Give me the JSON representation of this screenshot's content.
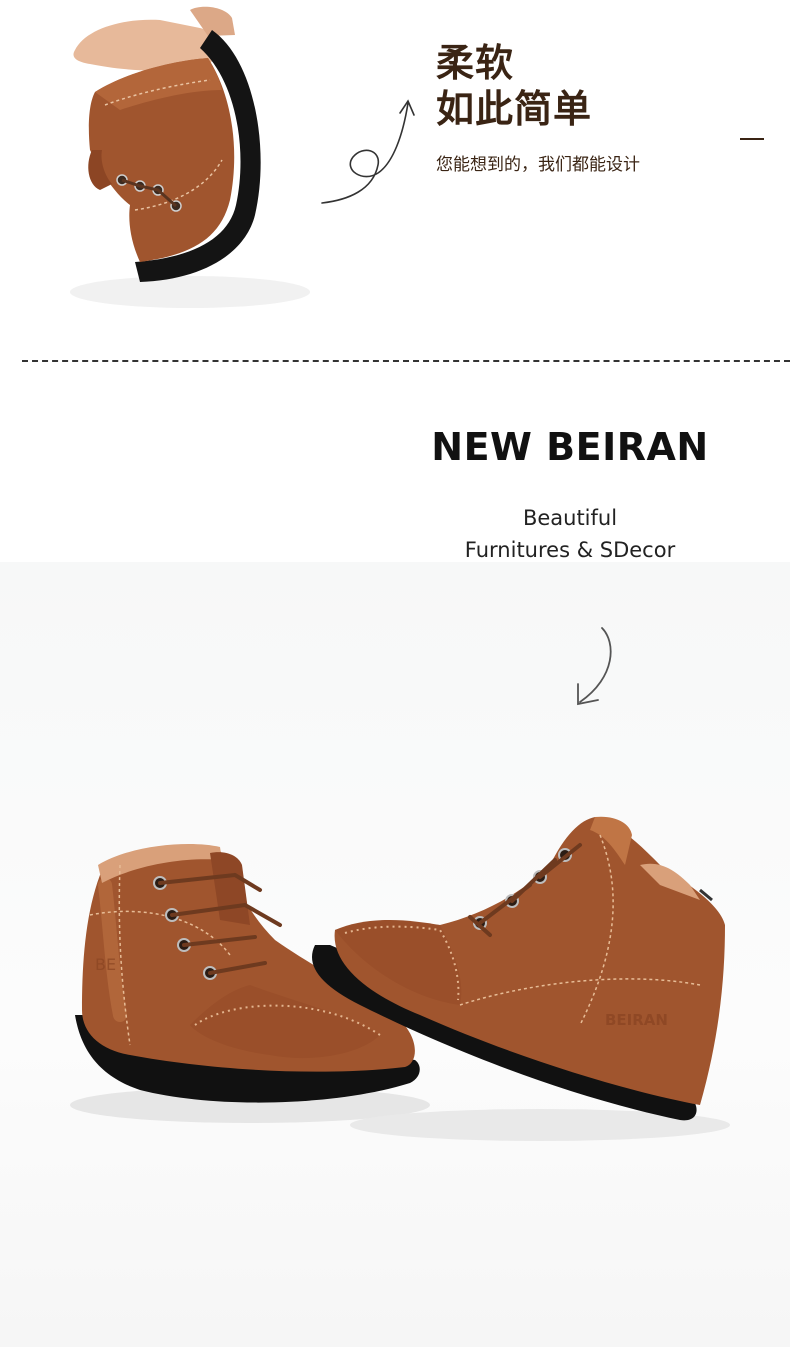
{
  "hero": {
    "headline_line1": "柔软",
    "headline_line2": "如此简单",
    "subheadline": "您能想到的，我们都能设计",
    "image_alt": "Hand bending a brown leather shoe to show flexible sole"
  },
  "brand": {
    "title": "NEW BEIRAN",
    "tagline_line1": "Beautiful",
    "tagline_line2": "Furnitures & SDecor"
  },
  "product": {
    "image_alt": "Pair of brown leather lace-up brogue boots for kids",
    "shoe_logo_text": "BEIRAN"
  },
  "colors": {
    "leather_brown": "#a0552e",
    "dark_brown_text": "#3a2414",
    "sole_black": "#111111"
  }
}
